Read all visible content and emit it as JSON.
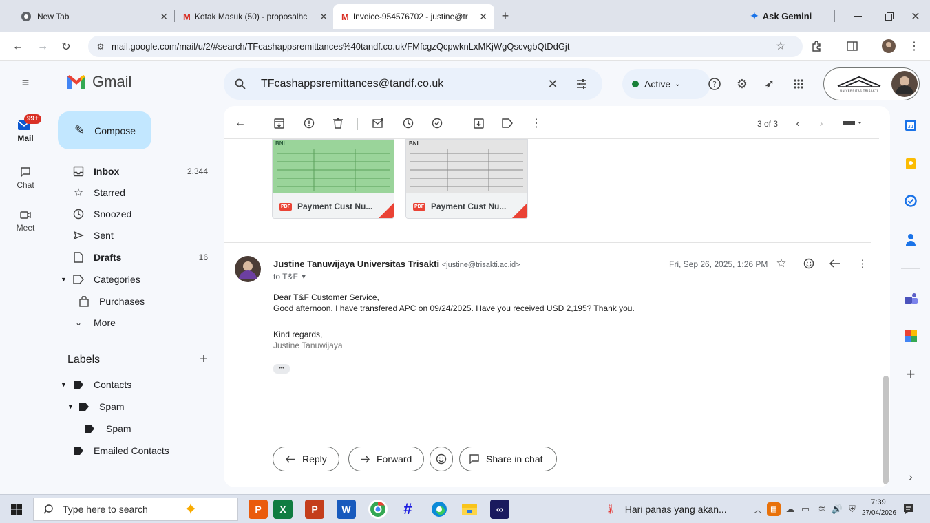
{
  "browser": {
    "tabs": [
      {
        "title": "New Tab"
      },
      {
        "title": "Kotak Masuk (50) - proposalhc"
      },
      {
        "title": "Invoice-954576702 - justine@tr"
      }
    ],
    "gemini_label": "Ask Gemini",
    "url": "mail.google.com/mail/u/2/#search/TFcashappsremittances%40tandf.co.uk/FMfcgzQcpwknLxMKjWgQscvgbQtDdGjt"
  },
  "gmail": {
    "logo_text": "Gmail",
    "rail": {
      "mail_label": "Mail",
      "mail_badge": "99+",
      "chat_label": "Chat",
      "meet_label": "Meet"
    },
    "compose_label": "Compose",
    "nav": [
      {
        "label": "Inbox",
        "count": "2,344"
      },
      {
        "label": "Starred",
        "count": ""
      },
      {
        "label": "Snoozed",
        "count": ""
      },
      {
        "label": "Sent",
        "count": ""
      },
      {
        "label": "Drafts",
        "count": "16"
      },
      {
        "label": "Categories",
        "count": ""
      },
      {
        "label": "Purchases",
        "count": ""
      },
      {
        "label": "More",
        "count": ""
      }
    ],
    "labels_title": "Labels",
    "labels": [
      {
        "label": "Contacts"
      },
      {
        "label": "Spam"
      },
      {
        "label": "Spam"
      },
      {
        "label": "Emailed Contacts"
      }
    ],
    "search_value": "TFcashappsremittances@tandf.co.uk",
    "status_label": "Active",
    "pager": "3 of 3",
    "attachments": [
      {
        "name": "Payment Cust Nu...",
        "type": "PDF",
        "bank": "BNI"
      },
      {
        "name": "Payment Cust Nu...",
        "type": "PDF",
        "bank": "BNI"
      }
    ],
    "message": {
      "sender_name": "Justine Tanuwijaya Universitas Trisakti",
      "sender_email": "<justine@trisakti.ac.id>",
      "to_line": "to T&F",
      "date": "Fri, Sep 26, 2025, 1:26 PM",
      "body": [
        "Dear T&F Customer Service,",
        "Good afternoon. I have transfered APC on 09/24/2025. Have you received USD 2,195? Thank you.",
        "",
        "Kind regards,"
      ],
      "signature": "Justine Tanuwijaya",
      "ellipsis": "•••"
    },
    "actions": {
      "reply": "Reply",
      "forward": "Forward",
      "share": "Share in chat"
    },
    "account_org": "UNIVERSITAS TRISAKTI"
  },
  "taskbar": {
    "search_placeholder": "Type here to search",
    "weather": "Hari panas yang akan...",
    "time": "7:39",
    "date": "27/04/2026"
  },
  "colors": {
    "accent": "#0b57d0",
    "compose_bg": "#c2e7ff",
    "active_dot": "#188038",
    "badge": "#d93025"
  }
}
